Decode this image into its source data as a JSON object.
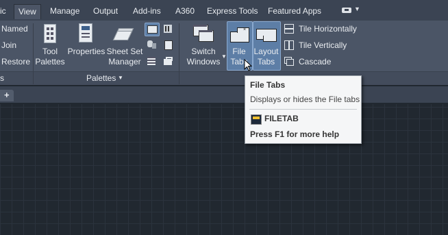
{
  "ribbon_tabs": [
    "ic",
    "View",
    "Manage",
    "Output",
    "Add-ins",
    "A360",
    "Express Tools",
    "Featured Apps"
  ],
  "active_tab": "View",
  "viewports_panel": {
    "named": "Named",
    "join": "Join",
    "restore": "Restore",
    "panel_label": "s"
  },
  "palettes_panel": {
    "tool_palettes": [
      "Tool",
      "Palettes"
    ],
    "properties": "Properties",
    "sheet_set_manager": [
      "Sheet Set",
      "Manager"
    ],
    "panel_label": "Palettes"
  },
  "interface_panel": {
    "switch_windows": [
      "Switch",
      "Windows"
    ],
    "file_tabs": [
      "File",
      "Tabs"
    ],
    "layout_tabs": [
      "Layout",
      "Tabs"
    ],
    "tile_horizontally": "Tile Horizontally",
    "tile_vertically": "Tile Vertically",
    "cascade": "Cascade"
  },
  "file_tab_strip": {
    "new_tab": "+"
  },
  "tooltip": {
    "title": "File Tabs",
    "description": "Displays or hides the File tabs",
    "command": "FILETAB",
    "help": "Press F1 for more help"
  },
  "colors": {
    "ribbon": "#4b5566",
    "tabbar": "#3b4453",
    "highlight": "#5d7ea6",
    "canvas": "#212830"
  }
}
